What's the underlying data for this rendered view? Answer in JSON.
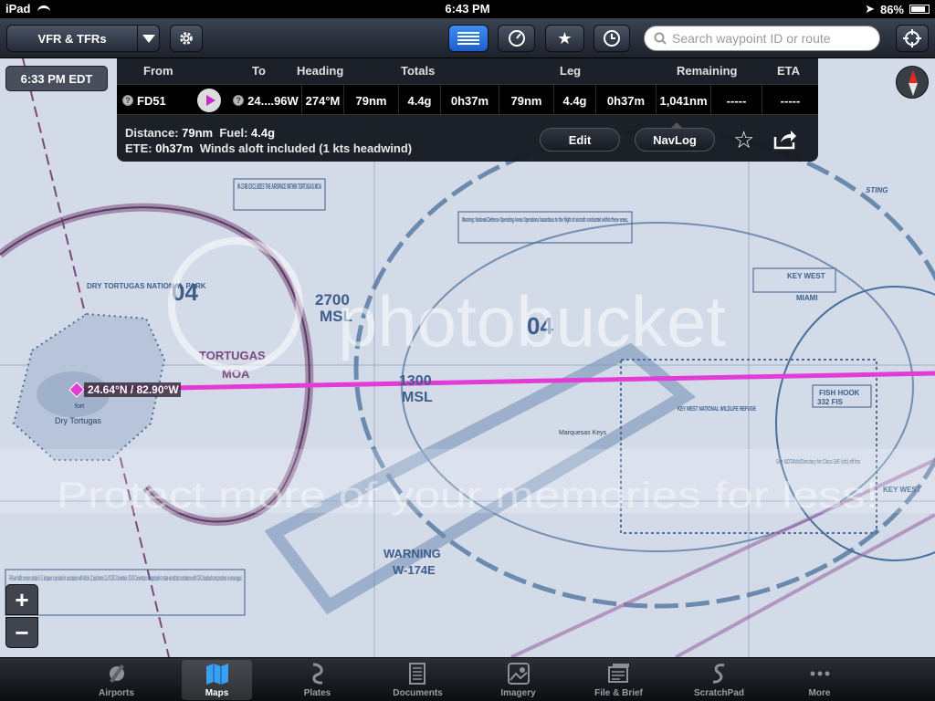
{
  "status_bar": {
    "device": "iPad",
    "time": "6:43 PM",
    "battery": "86%",
    "battery_level": 0.86
  },
  "toolbar": {
    "layer_label": "VFR & TFRs",
    "search_placeholder": "Search waypoint ID or route"
  },
  "map": {
    "time_label": "6:33 PM EDT",
    "position_label": "24.64°N / 82.90°W",
    "chart_labels": {
      "w174b": "W-174B EXCLUDES THE AIRSPACE WITHIN TORTUGAS MOA",
      "dry_tortugas_np": "DRY TORTUGAS NATIONAL PARK",
      "floor_04_left": "04",
      "floor_04_right": "04",
      "msl_2700": "2700",
      "msl_2700_unit": "MSL",
      "msl_1300": "1300",
      "msl_1300_unit": "MSL",
      "tortugas": "TORTUGAS",
      "moa": "MOA",
      "dry_tortugas": "Dry Tortugas",
      "fort": "fort",
      "warning_box": "Warning: National Defense Operating Areas Operations hazardous to the flight of aircraft conducted within these areas.",
      "warning": "WARNING",
      "w174e": "W-174E",
      "marquesas": "Marquesas Keys",
      "kw_refuge": "KEY WEST NATIONAL WILDLIFE REFUGE",
      "key_west_freq": "KEY WEST",
      "miami": "MIAMI",
      "fish_hook": "FISH HOOK",
      "fish_hook_freq": "332 FIS",
      "key_west_city": "KEY WEST",
      "notams": "See NOTAMs/Directory for Class D/E (sfc) eff hrs",
      "sting": "STING",
      "faa_notice": "FAA air traffic service outside U.S. airspace is provided in accordance with Article 12 and Annex 11 of ICAO Convention. ICAO Convention not applicable to state aircraft but compliance with ICAO standards and practices is encouraged."
    },
    "watermark": {
      "brand": "photobucket",
      "slogan": "Protect more of your memories for less!"
    }
  },
  "route_panel": {
    "headers": {
      "from": "From",
      "to": "To",
      "heading": "Heading",
      "totals": "Totals",
      "leg": "Leg",
      "remaining": "Remaining",
      "eta": "ETA"
    },
    "row": {
      "from": "FD51",
      "to": "24....96W",
      "heading": "274°M",
      "total_dist": "79nm",
      "total_fuel": "4.4g",
      "total_time": "0h37m",
      "leg_dist": "79nm",
      "leg_fuel": "4.4g",
      "leg_time": "0h37m",
      "remaining": "1,041nm",
      "remaining_extra": "-----",
      "eta": "-----"
    },
    "summary": {
      "distance_label": "Distance:",
      "distance": "79nm",
      "fuel_label": "Fuel:",
      "fuel": "4.4g",
      "ete_label": "ETE:",
      "ete": "0h37m",
      "winds": "Winds aloft included (1 kts headwind)"
    },
    "buttons": {
      "edit": "Edit",
      "navlog": "NavLog"
    }
  },
  "zoom": {
    "in": "+",
    "out": "−"
  },
  "tabs": [
    {
      "label": "Airports",
      "icon": "airport-icon"
    },
    {
      "label": "Maps",
      "icon": "map-icon"
    },
    {
      "label": "Plates",
      "icon": "plates-icon"
    },
    {
      "label": "Documents",
      "icon": "documents-icon"
    },
    {
      "label": "Imagery",
      "icon": "imagery-icon"
    },
    {
      "label": "File & Brief",
      "icon": "file-brief-icon"
    },
    {
      "label": "ScratchPad",
      "icon": "scratchpad-icon"
    },
    {
      "label": "More",
      "icon": "more-icon"
    }
  ],
  "active_tab": "Maps",
  "colors": {
    "map_bg": "#d3dbe9",
    "chart_blue": "#4a6f9a",
    "moa_purple": "#7a4a7e",
    "route_magenta": "#e43ad6",
    "toolbar_active": "#2f7ae8"
  }
}
